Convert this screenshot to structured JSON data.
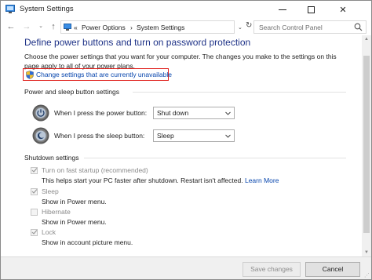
{
  "window": {
    "title": "System Settings"
  },
  "titlebar": {
    "minimize_icon": "minimize-icon",
    "maximize_icon": "maximize-icon",
    "close_icon": "close-icon",
    "close_glyph": "✕"
  },
  "nav": {
    "back_glyph": "←",
    "forward_glyph": "→",
    "recent_glyph": "⌄",
    "up_glyph": "↑",
    "breadcrumb_prefix": "«",
    "breadcrumb": [
      "Power Options",
      "System Settings"
    ],
    "separator": "›",
    "dropdown_glyph": "⌄",
    "refresh_glyph": "↻",
    "search_placeholder": "Search Control Panel"
  },
  "main": {
    "title": "Define power buttons and turn on password protection",
    "description": "Choose the power settings that you want for your computer. The changes you make to the settings on this page apply to all of your power plans.",
    "change_settings_link": "Change settings that are currently unavailable",
    "power_section": {
      "heading": "Power and sleep button settings",
      "rows": [
        {
          "label": "When I press the power button:",
          "value": "Shut down",
          "icon": "power-icon"
        },
        {
          "label": "When I press the sleep button:",
          "value": "Sleep",
          "icon": "sleep-icon"
        }
      ]
    },
    "shutdown_section": {
      "heading": "Shutdown settings",
      "items": [
        {
          "label": "Turn on fast startup (recommended)",
          "checked": true,
          "description": "This helps start your PC faster after shutdown. Restart isn't affected.",
          "link": "Learn More"
        },
        {
          "label": "Sleep",
          "checked": true,
          "description": "Show in Power menu."
        },
        {
          "label": "Hibernate",
          "checked": false,
          "description": "Show in Power menu."
        },
        {
          "label": "Lock",
          "checked": true,
          "description": "Show in account picture menu."
        }
      ]
    }
  },
  "footer": {
    "save_label": "Save changes",
    "cancel_label": "Cancel"
  },
  "colors": {
    "title_blue": "#1e3287",
    "link_blue": "#0645ad",
    "highlight_red": "#e0201c",
    "disabled_gray": "#8a8a8a"
  }
}
